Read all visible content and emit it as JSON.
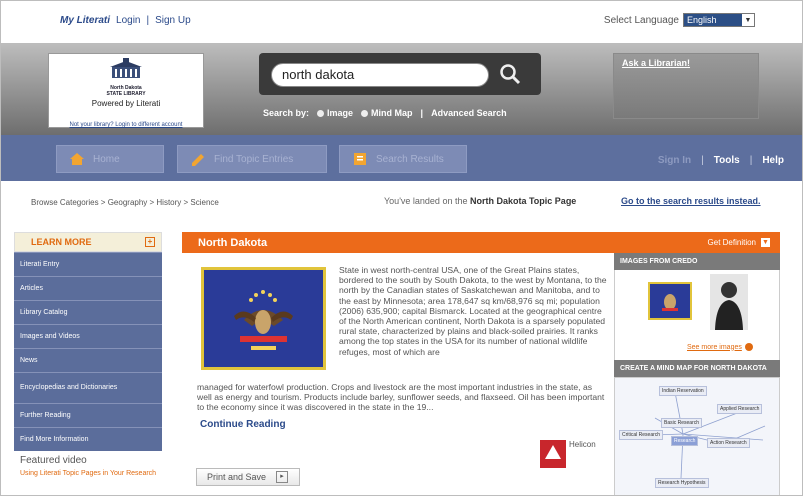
{
  "topbar": {
    "my_literati": "My Literati",
    "login": "Login",
    "sign_up": "Sign Up",
    "select_language_label": "Select Language",
    "language_value": "English"
  },
  "logo": {
    "small_line1": "North Dakota",
    "small_line2": "STATE LIBRARY",
    "powered": "Powered by Literati",
    "link": "Not your library? Login to different account"
  },
  "search": {
    "value": "north dakota",
    "search_by_label": "Search by:",
    "option_image": "Image",
    "option_mind_map": "Mind Map",
    "advanced": "Advanced Search"
  },
  "ask_librarian": "Ask a Librarian!",
  "nav": {
    "home": "Home",
    "find_topics": "Find Topic Entries",
    "search_results": "Search Results",
    "sign_in": "Sign In",
    "tools": "Tools",
    "help": "Help"
  },
  "breadcrumb": "Browse Categories > Geography > History > Science",
  "landed": {
    "prefix": "You've landed on the ",
    "page": "North Dakota Topic Page",
    "goto": "Go to the search results instead."
  },
  "sidebar": {
    "learn_more": "LEARN MORE",
    "items": [
      {
        "label": "Literati Entry"
      },
      {
        "label": "Articles"
      },
      {
        "label": "Library Catalog"
      },
      {
        "label": "Images and Videos"
      },
      {
        "label": "News"
      },
      {
        "label": "Encyclopedias and Dictionaries"
      },
      {
        "label": "Further Reading"
      },
      {
        "label": "Find More Information"
      }
    ],
    "featured_video": "Featured video",
    "featured_link": "Using Literati Topic Pages in Your Research"
  },
  "main": {
    "title": "North Dakota",
    "description": "State in west north-central USA, one of the Great Plains states, bordered to the south by South Dakota, to the west by Montana, to the north by the Canadian states of Saskatchewan and Manitoba, and to the east by Minnesota; area 178,647 sq km/68,976 sq mi; population (2006) 635,900; capital Bismarck. Located at the geographical centre of the North American continent, North Dakota is a sparsely populated rural state, characterized by plains and black-soiled prairies. It ranks among the top states in the USA for its number of national wildlife refuges, most of which are",
    "description_cont": "managed for waterfowl production. Crops and livestock are the most important industries in the state, as well as energy and tourism. Products include barley, sunflower seeds, and flaxseed. Oil has been important to the economy since it was discovered in the state in the 19...",
    "continue": "Continue Reading",
    "helicon": "Helicon",
    "print_save": "Print and Save"
  },
  "right": {
    "get_definition": "Get Definition",
    "images_head": "IMAGES FROM CREDO",
    "see_more": "See more images",
    "mindmap_head": "CREATE A MIND MAP FOR NORTH DAKOTA",
    "nodes": [
      "Indian Reservation",
      "Basic Research",
      "Applied Research",
      "Research",
      "Action Research",
      "Critical Research",
      "Research Hypothesis"
    ]
  },
  "colors": {
    "accent_orange": "#ec6a1a",
    "nav_blue": "#5d6f9e",
    "link_blue": "#2b4a8a"
  }
}
